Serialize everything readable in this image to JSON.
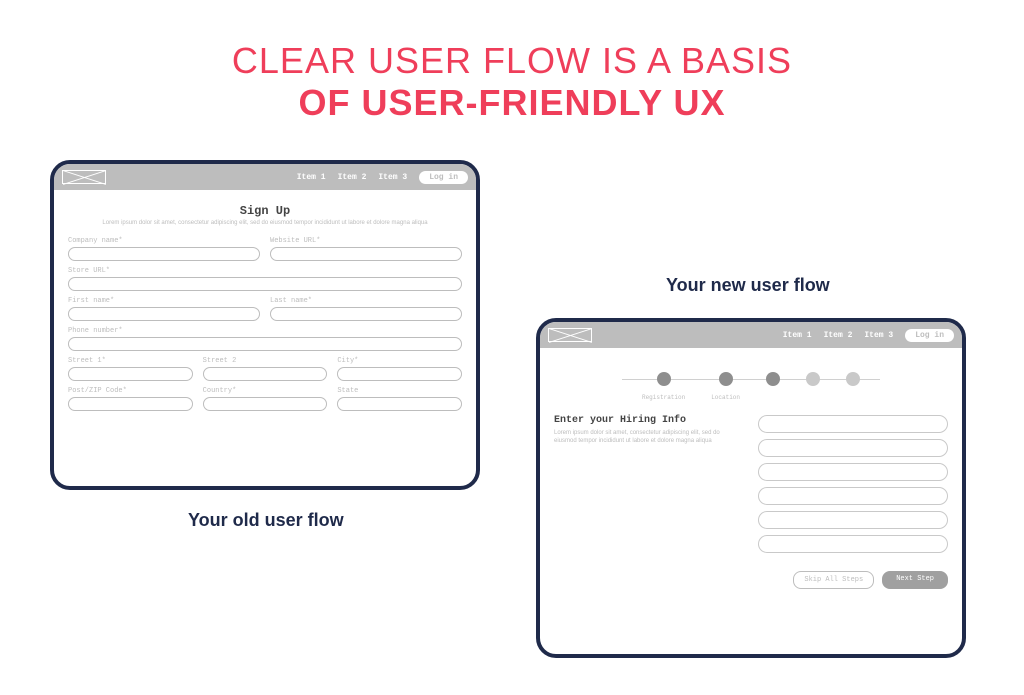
{
  "title": {
    "line1": "CLEAR USER FLOW IS A BASIS",
    "line2": "OF USER-FRIENDLY UX"
  },
  "captions": {
    "old": "Your old user flow",
    "new": "Your new user flow"
  },
  "nav": {
    "items": [
      "Item 1",
      "Item 2",
      "Item 3"
    ],
    "login": "Log in"
  },
  "old_form": {
    "heading": "Sign Up",
    "sub": "Lorem ipsum dolor sit amet, consectetur adipiscing elit, sed do eiusmod tempor incididunt ut labore et dolore magna aliqua",
    "fields": {
      "company": "Company name*",
      "url": "Website URL*",
      "store": "Store URL*",
      "first": "First name*",
      "last": "Last name*",
      "phone": "Phone number*",
      "street1": "Street 1*",
      "street2": "Street 2",
      "city": "City*",
      "zip": "Post/ZIP Code*",
      "country": "Country*",
      "state": "State"
    }
  },
  "new_form": {
    "steps": [
      {
        "label": "Registration",
        "active": true
      },
      {
        "label": "Location",
        "active": true
      },
      {
        "label": "",
        "active": true
      },
      {
        "label": "",
        "active": false
      },
      {
        "label": "",
        "active": false
      }
    ],
    "heading": "Enter your Hiring Info",
    "sub": "Lorem ipsum dolor sit amet, consectetur adipiscing elit, sed do eiusmod tempor incididunt ut labore et dolore magna aliqua",
    "input_count": 6,
    "buttons": {
      "skip": "Skip All Steps",
      "next": "Next Step"
    }
  }
}
